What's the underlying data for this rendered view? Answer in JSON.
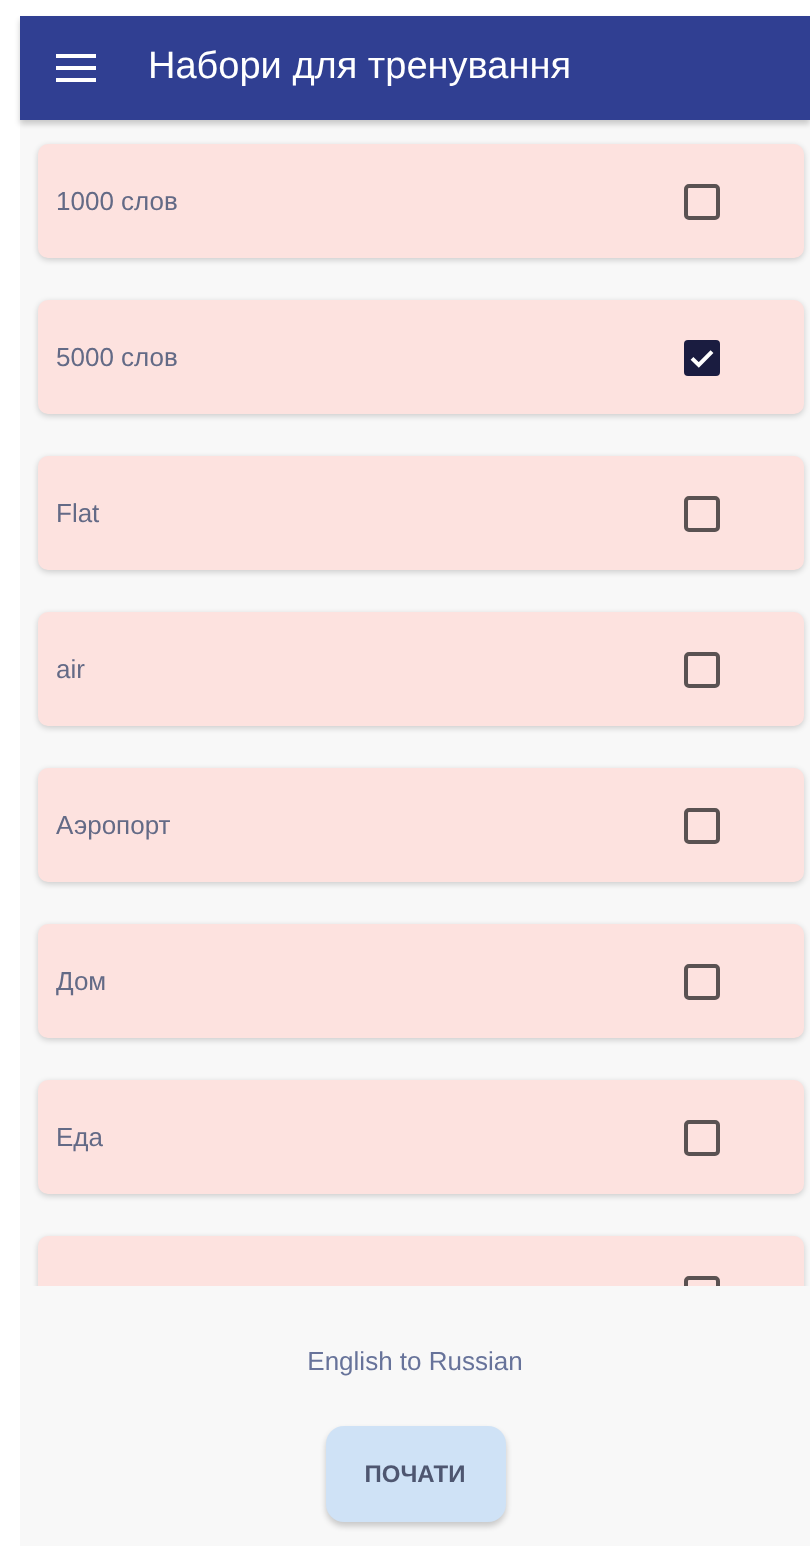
{
  "app_bar": {
    "title": "Набори для тренування"
  },
  "sets": [
    {
      "label": "1000 слов",
      "checked": false
    },
    {
      "label": "5000 слов",
      "checked": true
    },
    {
      "label": "Flat",
      "checked": false
    },
    {
      "label": "air",
      "checked": false
    },
    {
      "label": "Аэропорт",
      "checked": false
    },
    {
      "label": "Дом",
      "checked": false
    },
    {
      "label": "Еда",
      "checked": false
    },
    {
      "checked": false
    }
  ],
  "direction": "English to Russian",
  "start_button": "ПОЧАТИ"
}
